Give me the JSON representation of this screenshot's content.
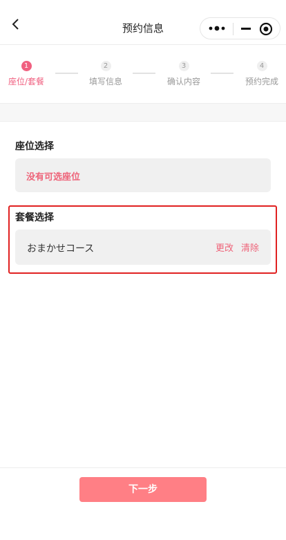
{
  "navbar": {
    "title": "预约信息",
    "back_icon": "chevron-left-icon",
    "capsule": {
      "more_icon": "more-dots-icon",
      "minimize_icon": "minimize-icon",
      "close_icon": "target-close-icon"
    }
  },
  "steps": [
    {
      "number": "1",
      "label": "座位/套餐",
      "active": true
    },
    {
      "number": "2",
      "label": "填写信息",
      "active": false
    },
    {
      "number": "3",
      "label": "确认内容",
      "active": false
    },
    {
      "number": "4",
      "label": "预约完成",
      "active": false
    }
  ],
  "seat_section": {
    "title": "座位选择",
    "empty_text": "没有可选座位"
  },
  "course_section": {
    "title": "套餐选择",
    "course_name": "おまかせコース",
    "change_label": "更改",
    "clear_label": "清除"
  },
  "footer": {
    "next_label": "下一步"
  },
  "colors": {
    "accent": "#ee6379",
    "button": "#ff7f85",
    "highlight_frame": "#e02020"
  }
}
